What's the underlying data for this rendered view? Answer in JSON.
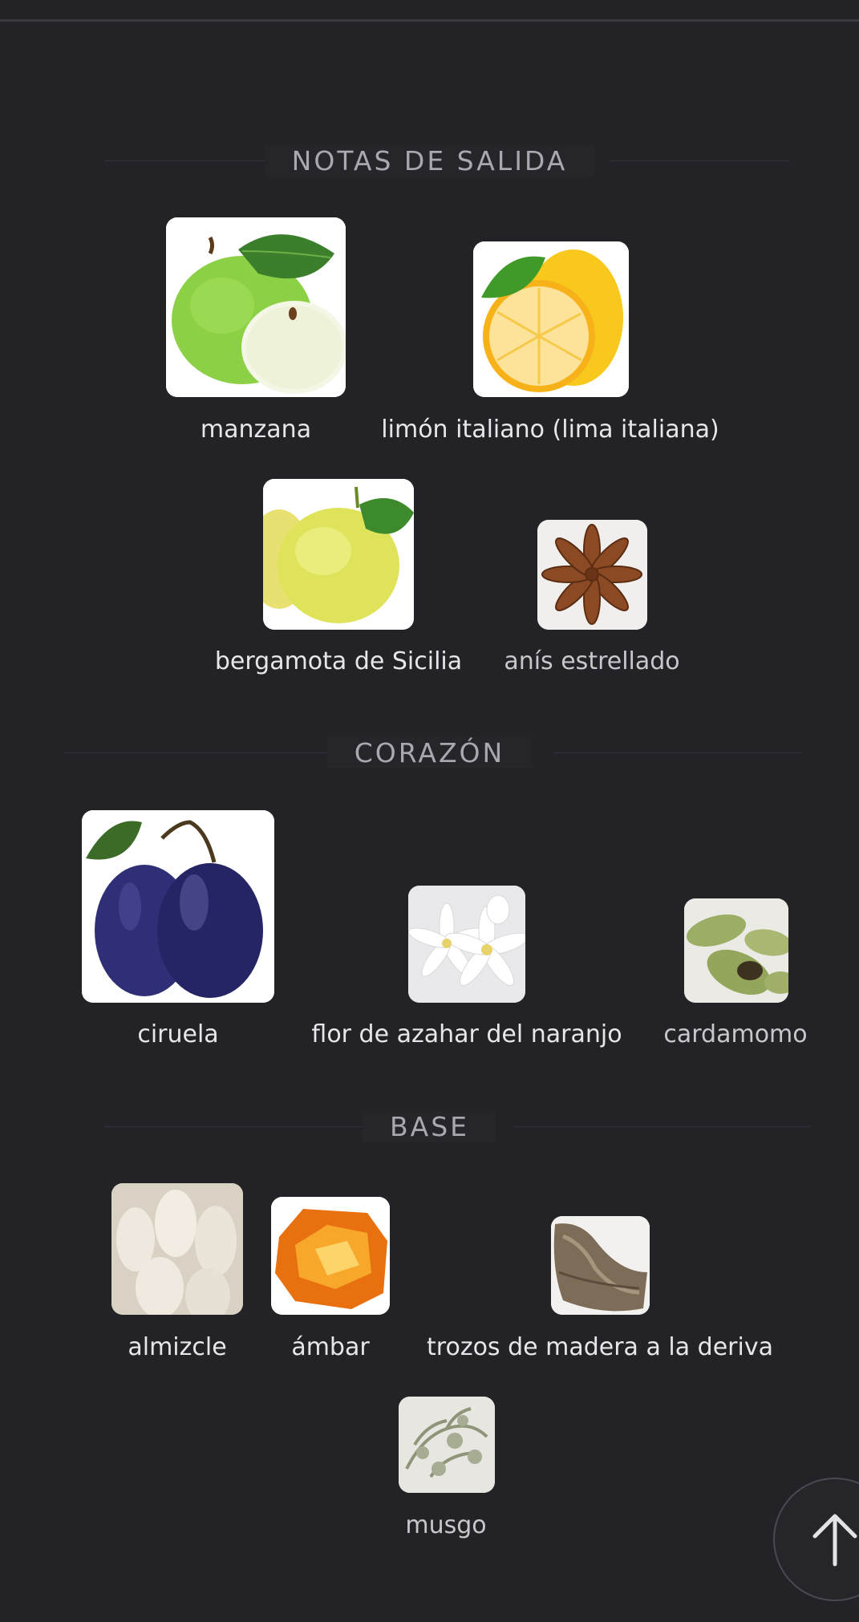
{
  "sections": {
    "top": {
      "title": "NOTAS DE SALIDA",
      "notes": [
        {
          "name": "manzana",
          "image": "green-apple-icon"
        },
        {
          "name": "limón italiano (lima italiana)",
          "image": "lemon-icon"
        },
        {
          "name": "bergamota de Sicilia",
          "image": "bergamot-icon"
        },
        {
          "name": "anís estrellado",
          "image": "star-anise-icon"
        }
      ]
    },
    "heart": {
      "title": "CORAZÓN",
      "notes": [
        {
          "name": "ciruela",
          "image": "plum-icon"
        },
        {
          "name": "flor de azahar del naranjo",
          "image": "orange-blossom-icon"
        },
        {
          "name": "cardamomo",
          "image": "cardamom-icon"
        }
      ]
    },
    "base": {
      "title": "BASE",
      "notes": [
        {
          "name": "almizcle",
          "image": "musk-icon"
        },
        {
          "name": "ámbar",
          "image": "amber-icon"
        },
        {
          "name": "trozos de madera a la deriva",
          "image": "driftwood-icon"
        },
        {
          "name": "musgo",
          "image": "moss-icon"
        }
      ]
    }
  },
  "scroll_top": {
    "icon": "arrow-up-icon"
  }
}
